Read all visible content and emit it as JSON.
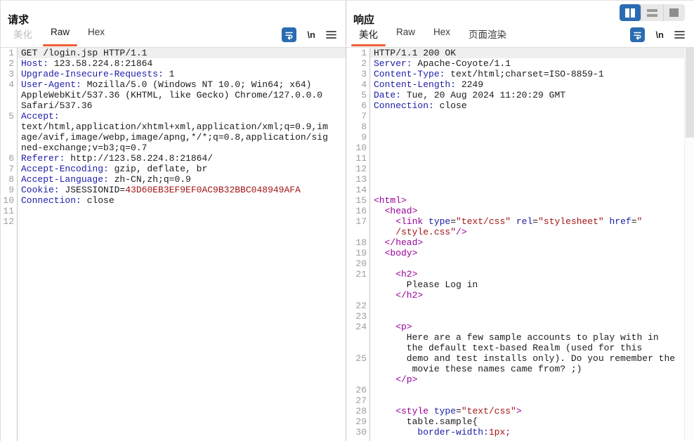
{
  "layout_switch": {
    "active": 0,
    "buttons": [
      "split-vertical",
      "split-horizontal",
      "single-panel"
    ]
  },
  "toolbar": {
    "wrap_icon": "wrap-lines",
    "newline_label": "\\n",
    "menu_icon": "hamburger-menu"
  },
  "colors": {
    "accent_orange": "#ee5f32",
    "accent_blue": "#2a6cb1",
    "syntax_header_name": "#1c1ca8",
    "syntax_string_red": "#a31515",
    "syntax_tag_magenta": "#990099",
    "line_number_gray": "#9a9da1",
    "active_line_bg": "#efefef"
  },
  "request": {
    "title": "请求",
    "tabs": [
      {
        "label": "美化",
        "state": "disabled"
      },
      {
        "label": "Raw",
        "state": "active"
      },
      {
        "label": "Hex",
        "state": "normal"
      }
    ],
    "rows": [
      {
        "n": "1",
        "hl": true,
        "s": [
          [
            "p",
            "GET /login.jsp HTTP/1.1"
          ]
        ]
      },
      {
        "n": "2",
        "s": [
          [
            "h",
            "Host:"
          ],
          [
            "p",
            " 123.58.224.8:21864"
          ]
        ]
      },
      {
        "n": "3",
        "s": [
          [
            "h",
            "Upgrade-Insecure-Requests:"
          ],
          [
            "p",
            " 1"
          ]
        ]
      },
      {
        "n": "4",
        "s": [
          [
            "h",
            "User-Agent:"
          ],
          [
            "p",
            " Mozilla/5.0 (Windows NT 10.0; Win64; x64)"
          ]
        ]
      },
      {
        "n": "",
        "s": [
          [
            "p",
            "AppleWebKit/537.36 (KHTML, like Gecko) Chrome/127.0.0.0"
          ]
        ]
      },
      {
        "n": "",
        "s": [
          [
            "p",
            "Safari/537.36"
          ]
        ]
      },
      {
        "n": "5",
        "s": [
          [
            "h",
            "Accept:"
          ]
        ]
      },
      {
        "n": "",
        "s": [
          [
            "p",
            "text/html,application/xhtml+xml,application/xml;q=0.9,im"
          ]
        ]
      },
      {
        "n": "",
        "s": [
          [
            "p",
            "age/avif,image/webp,image/apng,*/*;q=0.8,application/sig"
          ]
        ]
      },
      {
        "n": "",
        "s": [
          [
            "p",
            "ned-exchange;v=b3;q=0.7"
          ]
        ]
      },
      {
        "n": "6",
        "s": [
          [
            "h",
            "Referer:"
          ],
          [
            "p",
            " http://123.58.224.8:21864/"
          ]
        ]
      },
      {
        "n": "7",
        "s": [
          [
            "h",
            "Accept-Encoding:"
          ],
          [
            "p",
            " gzip, deflate, br"
          ]
        ]
      },
      {
        "n": "8",
        "s": [
          [
            "h",
            "Accept-Language:"
          ],
          [
            "p",
            " zh-CN,zh;q=0.9"
          ]
        ]
      },
      {
        "n": "9",
        "s": [
          [
            "h",
            "Cookie:"
          ],
          [
            "p",
            " JSESSIONID="
          ],
          [
            "r",
            "43D60EB3EF9EF0AC9B32BBC048949AFA"
          ]
        ]
      },
      {
        "n": "10",
        "s": [
          [
            "h",
            "Connection:"
          ],
          [
            "p",
            " close"
          ]
        ]
      },
      {
        "n": "11",
        "s": []
      },
      {
        "n": "12",
        "s": []
      }
    ]
  },
  "response": {
    "title": "响应",
    "tabs": [
      {
        "label": "美化",
        "state": "active"
      },
      {
        "label": "Raw",
        "state": "normal"
      },
      {
        "label": "Hex",
        "state": "normal"
      },
      {
        "label": "页面渲染",
        "state": "normal"
      }
    ],
    "rows": [
      {
        "n": "1",
        "hl": true,
        "s": [
          [
            "p",
            "HTTP/1.1 200 OK"
          ]
        ]
      },
      {
        "n": "2",
        "s": [
          [
            "h",
            "Server:"
          ],
          [
            "p",
            " Apache-Coyote/1.1"
          ]
        ]
      },
      {
        "n": "3",
        "s": [
          [
            "h",
            "Content-Type:"
          ],
          [
            "p",
            " text/html;charset=ISO-8859-1"
          ]
        ]
      },
      {
        "n": "4",
        "s": [
          [
            "h",
            "Content-Length:"
          ],
          [
            "p",
            " 2249"
          ]
        ]
      },
      {
        "n": "5",
        "s": [
          [
            "h",
            "Date:"
          ],
          [
            "p",
            " Tue, 20 Aug 2024 11:20:29 GMT"
          ]
        ]
      },
      {
        "n": "6",
        "s": [
          [
            "h",
            "Connection:"
          ],
          [
            "p",
            " close"
          ]
        ]
      },
      {
        "n": "7",
        "s": []
      },
      {
        "n": "8",
        "s": []
      },
      {
        "n": "9",
        "s": []
      },
      {
        "n": "10",
        "s": []
      },
      {
        "n": "11",
        "s": []
      },
      {
        "n": "12",
        "s": []
      },
      {
        "n": "13",
        "s": []
      },
      {
        "n": "14",
        "s": []
      },
      {
        "n": "15",
        "s": [
          [
            "t",
            "<html>"
          ]
        ]
      },
      {
        "n": "16",
        "s": [
          [
            "t",
            "  <head>"
          ]
        ]
      },
      {
        "n": "17",
        "s": [
          [
            "t",
            "    <link"
          ],
          [
            "a",
            " type"
          ],
          [
            "p",
            "="
          ],
          [
            "r",
            "\"text/css\""
          ],
          [
            "a",
            " rel"
          ],
          [
            "p",
            "="
          ],
          [
            "r",
            "\"stylesheet\""
          ],
          [
            "a",
            " href"
          ],
          [
            "p",
            "="
          ],
          [
            "r",
            "\""
          ]
        ]
      },
      {
        "n": "",
        "s": [
          [
            "p",
            "    "
          ],
          [
            "r",
            "/style.css\""
          ],
          [
            "t",
            "/>"
          ]
        ]
      },
      {
        "n": "18",
        "s": [
          [
            "t",
            "  </head>"
          ]
        ]
      },
      {
        "n": "19",
        "s": [
          [
            "t",
            "  <body>"
          ]
        ]
      },
      {
        "n": "20",
        "s": []
      },
      {
        "n": "21",
        "s": [
          [
            "t",
            "    <h2>"
          ]
        ]
      },
      {
        "n": "",
        "s": [
          [
            "p",
            "      Please Log in"
          ]
        ]
      },
      {
        "n": "",
        "s": [
          [
            "t",
            "    </h2>"
          ]
        ]
      },
      {
        "n": "22",
        "s": []
      },
      {
        "n": "23",
        "s": []
      },
      {
        "n": "24",
        "s": [
          [
            "t",
            "    <p>"
          ]
        ]
      },
      {
        "n": "",
        "s": [
          [
            "p",
            "      Here are a few sample accounts to play with in"
          ]
        ]
      },
      {
        "n": "",
        "s": [
          [
            "p",
            "      the default text-based Realm (used for this"
          ]
        ]
      },
      {
        "n": "25",
        "s": [
          [
            "p",
            "      demo and test installs only). Do you remember the"
          ]
        ]
      },
      {
        "n": "",
        "s": [
          [
            "p",
            "       movie these names came from? ;)"
          ]
        ]
      },
      {
        "n": "",
        "s": [
          [
            "t",
            "    </p>"
          ]
        ]
      },
      {
        "n": "26",
        "s": []
      },
      {
        "n": "27",
        "s": []
      },
      {
        "n": "28",
        "s": [
          [
            "t",
            "    <style"
          ],
          [
            "a",
            " type"
          ],
          [
            "p",
            "="
          ],
          [
            "r",
            "\"text/css\""
          ],
          [
            "t",
            ">"
          ]
        ]
      },
      {
        "n": "29",
        "s": [
          [
            "p",
            "      table.sample{"
          ]
        ]
      },
      {
        "n": "30",
        "s": [
          [
            "p",
            "        "
          ],
          [
            "a",
            "border-width:"
          ],
          [
            "r",
            "1px;"
          ]
        ]
      }
    ]
  }
}
